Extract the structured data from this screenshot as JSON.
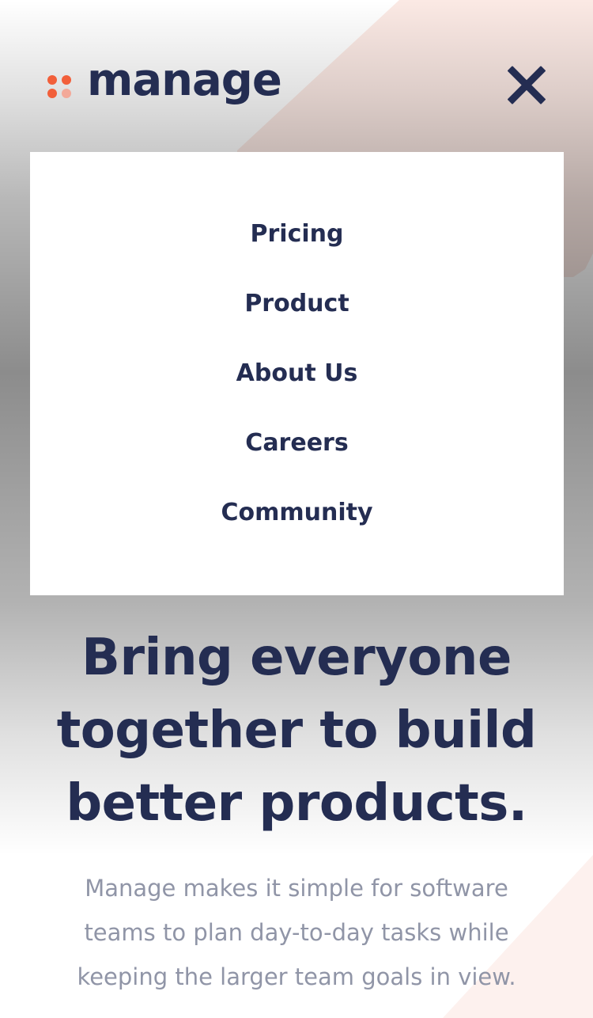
{
  "brand": {
    "name": "manage",
    "logo_icon": "four-dots-logo-icon",
    "colors": {
      "primary": "#242d52",
      "accent": "#f25f3a",
      "accent_light": "#f3a999",
      "muted_text": "#9095a7"
    }
  },
  "header": {
    "close_icon": "close-icon"
  },
  "menu": {
    "items": [
      {
        "label": "Pricing"
      },
      {
        "label": "Product"
      },
      {
        "label": "About Us"
      },
      {
        "label": "Careers"
      },
      {
        "label": "Community"
      }
    ]
  },
  "hero": {
    "title": "Bring everyone together to build better products.",
    "subtitle": "Manage makes it simple for software teams to plan day-to-day tasks while keeping the larger team goals in view."
  }
}
